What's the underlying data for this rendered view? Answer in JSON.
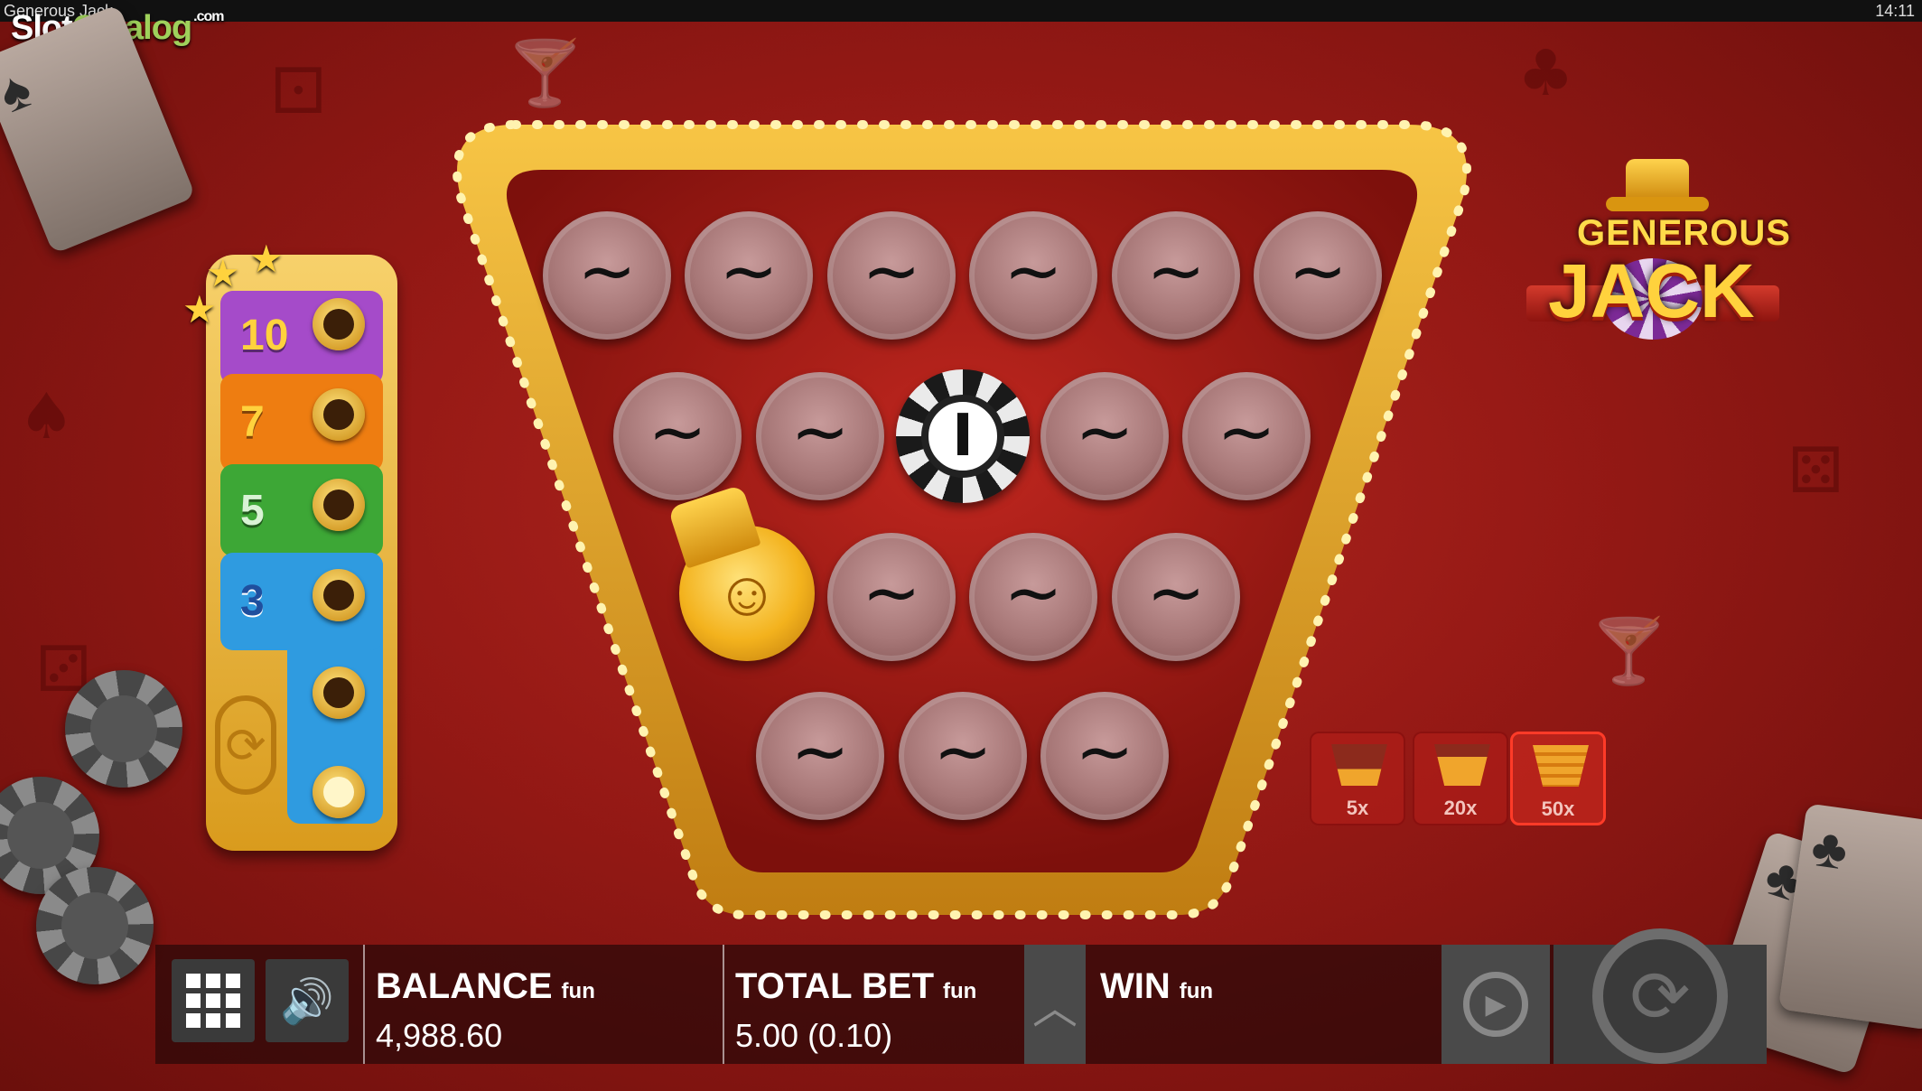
{
  "window": {
    "title": "Generous Jack",
    "clock": "14:11"
  },
  "watermark": {
    "slot": "Slot",
    "catalog": "Catalog",
    "com": ".com"
  },
  "logo": {
    "line1": "GENEROUS",
    "line2": "JACK"
  },
  "ladder": {
    "levels": [
      {
        "value": "10",
        "color": "#a54bc9"
      },
      {
        "value": "7",
        "color": "#ee7d11"
      },
      {
        "value": "5",
        "color": "#3da736"
      },
      {
        "value": "3",
        "color": "#2f9be0"
      }
    ],
    "respin_icon": "respin-icon"
  },
  "board": {
    "empty_symbol": "~",
    "chip_symbol": "I",
    "rows": [
      [
        "empty",
        "empty",
        "empty",
        "empty",
        "empty",
        "empty"
      ],
      [
        "empty",
        "empty",
        "chip",
        "empty",
        "empty"
      ],
      [
        "jack",
        "empty",
        "empty",
        "empty"
      ],
      [
        "empty",
        "empty",
        "empty"
      ]
    ]
  },
  "multipliers": [
    {
      "label": "5x",
      "active": false
    },
    {
      "label": "20x",
      "active": false
    },
    {
      "label": "50x",
      "active": true
    }
  ],
  "footer": {
    "menu_icon": "menu-grid-icon",
    "sound_icon": "speaker-icon",
    "balance_label": "BALANCE",
    "balance_unit": "fun",
    "balance_value": "4,988.60",
    "bet_label": "TOTAL BET",
    "bet_unit": "fun",
    "bet_value": "5.00 (0.10)",
    "win_label": "WIN",
    "win_unit": "fun",
    "win_value": "",
    "expand_icon": "chevron-up-icon",
    "autoplay_icon": "autoplay-icon",
    "spin_icon": "spin-icon"
  },
  "colors": {
    "felt": "#a11f1a",
    "marquee": "#f2b631",
    "bar": "#3a3a3a"
  }
}
